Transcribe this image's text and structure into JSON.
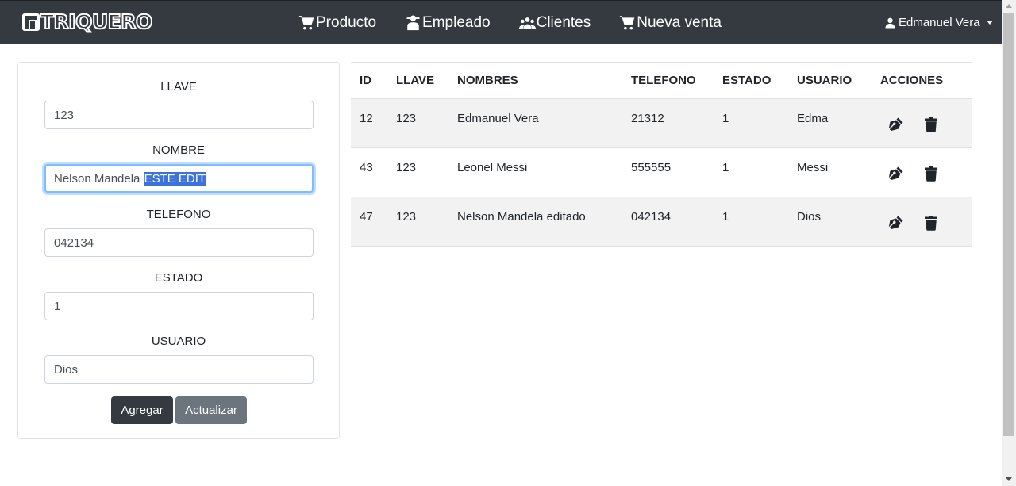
{
  "nav": {
    "brand": "TRIQUERO",
    "links": [
      {
        "label": "Producto",
        "icon": "cart-icon"
      },
      {
        "label": "Empleado",
        "icon": "employee-icon"
      },
      {
        "label": "Clientes",
        "icon": "clients-icon"
      },
      {
        "label": "Nueva venta",
        "icon": "cart-icon"
      }
    ],
    "user": "Edmanuel Vera"
  },
  "form": {
    "llave_label": "LLAVE",
    "llave_value": "123",
    "nombre_label": "NOMBRE",
    "nombre_value_plain": "Nelson Mandela ",
    "nombre_value_selected": "ESTE EDIT",
    "telefono_label": "TELEFONO",
    "telefono_value": "042134",
    "estado_label": "ESTADO",
    "estado_value": "1",
    "usuario_label": "USUARIO",
    "usuario_value": "Dios",
    "add_label": "Agregar",
    "update_label": "Actualizar"
  },
  "table": {
    "headers": [
      "ID",
      "LLAVE",
      "NOMBRES",
      "TELEFONO",
      "ESTADO",
      "USUARIO",
      "ACCIONES"
    ],
    "rows": [
      {
        "id": "12",
        "llave": "123",
        "nombres": "Edmanuel Vera",
        "telefono": "21312",
        "estado": "1",
        "usuario": "Edma"
      },
      {
        "id": "43",
        "llave": "123",
        "nombres": "Leonel Messi",
        "telefono": "555555",
        "estado": "1",
        "usuario": "Messi"
      },
      {
        "id": "47",
        "llave": "123",
        "nombres": "Nelson Mandela editado",
        "telefono": "042134",
        "estado": "1",
        "usuario": "Dios"
      }
    ]
  },
  "colors": {
    "navbar": "#343a40",
    "btn_dark": "#343a40",
    "btn_secondary": "#6c757d",
    "selection": "#3b73d9",
    "focus": "#80bdff"
  }
}
